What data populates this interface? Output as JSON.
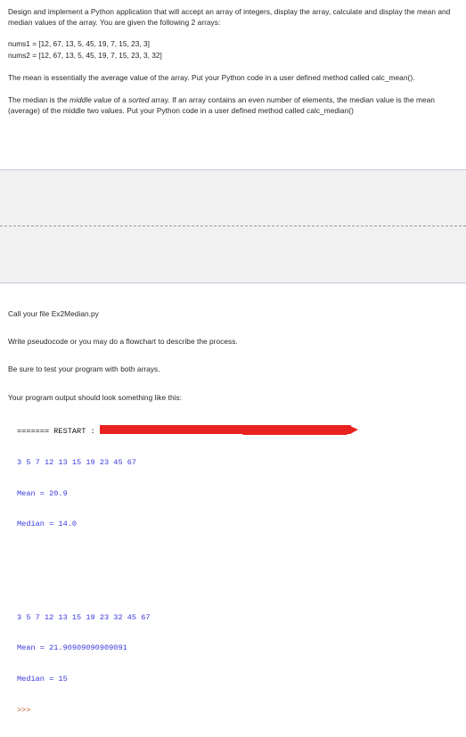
{
  "document": {
    "intro": {
      "paragraph": "Design and implement a Python application that will accept an array of integers, display the array, calculate and display the mean and median values of the array. You are given the following 2 arrays:"
    },
    "arrays": [
      "nums1 = [12, 67, 13, 5, 45, 19, 7, 15, 23, 3]",
      "nums2 = [12, 67, 13, 5, 45, 19, 7, 15, 23, 3, 32]"
    ],
    "mean_paragraph": {
      "before": "The mean is essentially the average value of the array. Put your Python code in a user defined method called calc_mean()."
    },
    "median_paragraph": {
      "part1": "The median is the ",
      "italic1": "middle value",
      "part2": " of a ",
      "italic2": "sorted",
      "part3": " array. If an array contains an even number of elements, the median value is the mean (average) of the middle two values.  Put your Python code in a user defined method called calc_median()"
    },
    "instructions": [
      "Call your file Ex2Median.py",
      "Write pseudocode or you may do a flowchart to describe the process.",
      "Be sure to test your program with both arrays.",
      "Your program output should look something like this:"
    ],
    "console": {
      "restart_label": "======= RESTART :",
      "run1": {
        "array": "3 5 7 12 13 15 19 23 45 67",
        "mean": "Mean = 20.9",
        "median": "Median = 14.0"
      },
      "run2": {
        "array": "3 5 7 12 13 15 19 23 32 45 67",
        "mean": "Mean = 21.90909090909091",
        "median": "Median = 15"
      },
      "prompt": ">>>"
    },
    "colors": {
      "redaction": "#e8231f",
      "console_blue": "#3a3ae0",
      "divider": "#c3cbd6",
      "band_background": "#f1f1f1"
    }
  }
}
